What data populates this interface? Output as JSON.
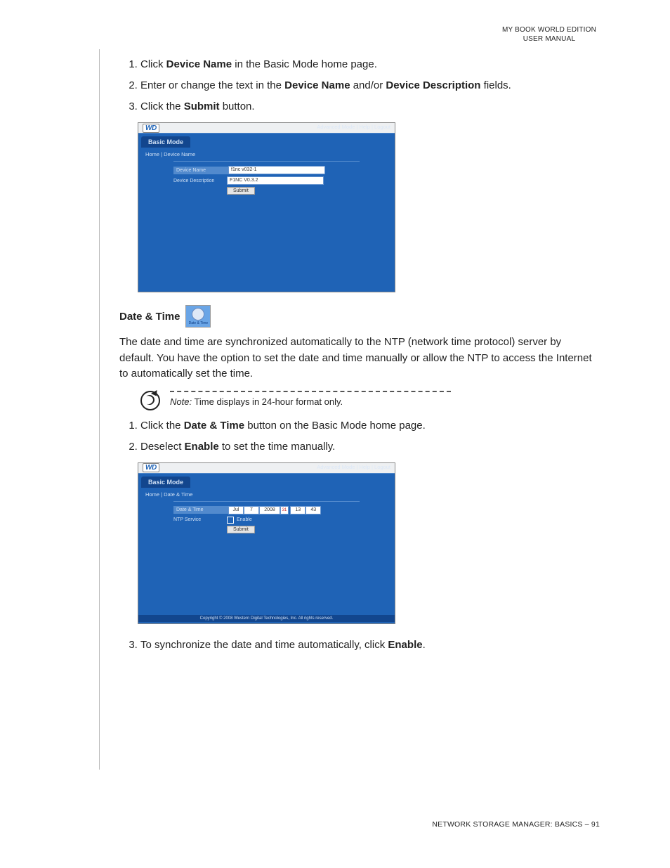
{
  "header": {
    "line1": "MY BOOK WORLD EDITION",
    "line2": "USER MANUAL"
  },
  "steps_a": {
    "s1_a": "Click ",
    "s1_b": "Device Name",
    "s1_c": " in the Basic Mode home page.",
    "s2_a": "Enter or change the text in the ",
    "s2_b": "Device Name",
    "s2_c": " and/or ",
    "s2_d": "Device Description",
    "s2_e": " fields.",
    "s3_a": "Click the ",
    "s3_b": "Submit",
    "s3_c": " button."
  },
  "shot1": {
    "logo": "WD",
    "links": "Advanced Mode   |   Help   |   Logout",
    "tab": "Basic Mode",
    "breadcrumb": "Home | Device Name",
    "row1_label": "Device Name",
    "row1_value": "f1nc v032-1",
    "row2_label": "Device Description",
    "row2_value": "F1NC V0.3.2",
    "submit": "Submit"
  },
  "section": {
    "title": "Date & Time",
    "icon_caption": "Date & Time"
  },
  "para1": "The date and time are synchronized automatically to the NTP (network time protocol) server by default. You have the option to set the date and time manually or allow the NTP to access the Internet to automatically set the time.",
  "note": {
    "label": "Note:",
    "text": " Time displays in 24-hour format only."
  },
  "steps_b": {
    "s1_a": "Click the ",
    "s1_b": "Date & Time",
    "s1_c": " button on the Basic Mode home page.",
    "s2_a": "Deselect ",
    "s2_b": "Enable",
    "s2_c": " to set the time manually."
  },
  "shot2": {
    "logo": "WD",
    "links": "Advanced Mode   |   Help   |   Logout",
    "tab": "Basic Mode",
    "breadcrumb": "Home | Date & Time",
    "row1_label": "Date & Time",
    "month": "Jul",
    "day": "7",
    "year": "2008",
    "hour": "13",
    "min": "43",
    "row2_label": "NTP Service",
    "row2_value": "Enable",
    "submit": "Submit",
    "copyright": "Copyright © 2008 Western Digital Technologies, Inc. All rights reserved."
  },
  "steps_c": {
    "s3_a": "To synchronize the date and time automatically, click ",
    "s3_b": "Enable",
    "s3_c": "."
  },
  "footer": "NETWORK STORAGE MANAGER: BASICS – 91"
}
